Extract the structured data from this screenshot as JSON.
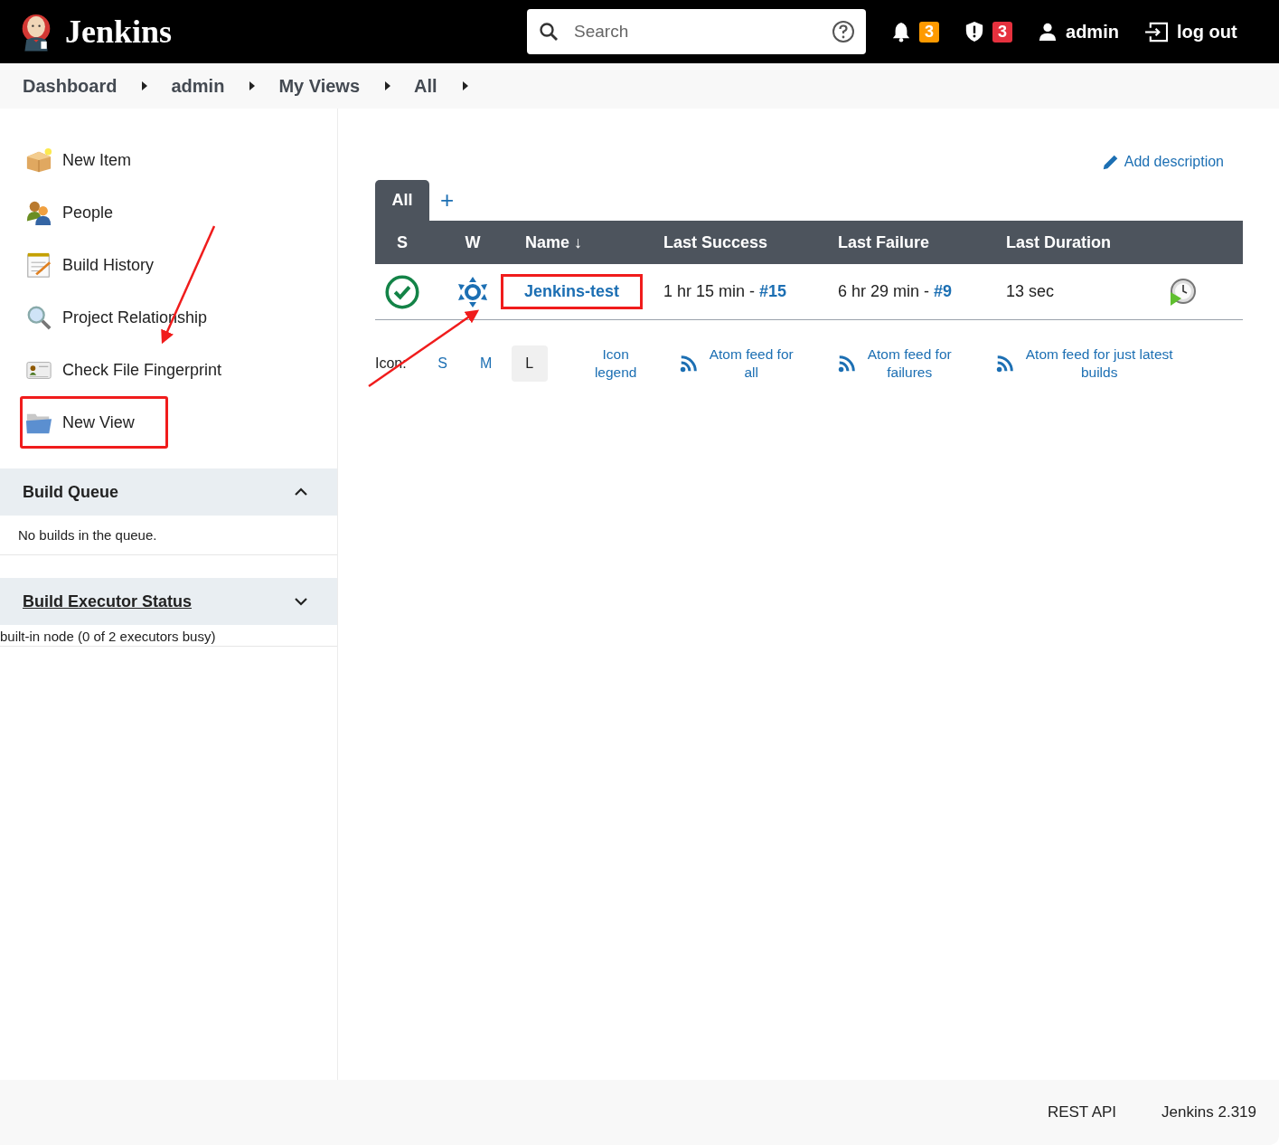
{
  "header": {
    "logo_text": "Jenkins",
    "search": {
      "placeholder": "Search"
    },
    "notifications": {
      "count": "3"
    },
    "security": {
      "count": "3"
    },
    "user": "admin",
    "logout": "log out"
  },
  "breadcrumbs": [
    {
      "label": "Dashboard"
    },
    {
      "label": "admin"
    },
    {
      "label": "My Views"
    },
    {
      "label": "All"
    }
  ],
  "sidebar": {
    "tasks": [
      {
        "label": "New Item",
        "annotated": false
      },
      {
        "label": "People",
        "annotated": false
      },
      {
        "label": "Build History",
        "annotated": false
      },
      {
        "label": "Project Relationship",
        "annotated": false
      },
      {
        "label": "Check File Fingerprint",
        "annotated": false
      },
      {
        "label": "New View",
        "annotated": true
      }
    ],
    "build_queue": {
      "title": "Build Queue",
      "expanded": true,
      "message": "No builds in the queue."
    },
    "executors": {
      "title": "Build Executor Status",
      "expanded": false,
      "message": "built-in node (0 of 2 executors busy)"
    }
  },
  "main": {
    "add_description": "Add description",
    "tabs": [
      {
        "label": "All",
        "selected": true
      }
    ],
    "add_tab": "+",
    "table": {
      "columns": [
        "S",
        "W",
        "Name ↓",
        "Last Success",
        "Last Failure",
        "Last Duration"
      ],
      "rows": [
        {
          "name": "Jenkins-test",
          "annotated": true,
          "last_success": {
            "time": "1 hr 15 min - ",
            "build": "#15"
          },
          "last_failure": {
            "time": "6 hr 29 min - ",
            "build": "#9"
          },
          "last_duration": "13 sec"
        }
      ]
    },
    "icon_sizes": {
      "label": "Icon:",
      "sizes": [
        {
          "label": "S",
          "selected": false
        },
        {
          "label": "M",
          "selected": false
        },
        {
          "label": "L",
          "selected": true
        }
      ]
    },
    "links": [
      {
        "label": "Icon legend",
        "kind": "plain"
      },
      {
        "label": "Atom feed for all",
        "kind": "feed"
      },
      {
        "label": "Atom feed for failures",
        "kind": "feed"
      },
      {
        "label": "Atom feed for just latest builds",
        "kind": "feed"
      }
    ]
  },
  "footer": {
    "links": [
      "REST API",
      "Jenkins 2.319"
    ]
  }
}
